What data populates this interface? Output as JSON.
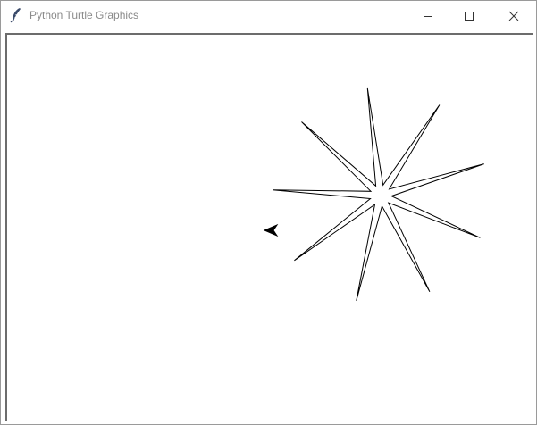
{
  "window": {
    "title": "Python Turtle Graphics",
    "icon": "feather-icon",
    "controls": [
      "minimize-icon",
      "maximize-icon",
      "close-icon"
    ]
  },
  "canvas": {
    "background": "#ffffff",
    "pen_color": "#000000",
    "drawing": "nine-pointed star",
    "turtle_shape": "classic arrow",
    "turtle_heading": "west"
  }
}
